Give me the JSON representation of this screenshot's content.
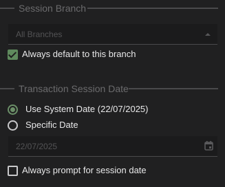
{
  "session_branch": {
    "title": "Session Branch",
    "dropdown_value": "All Branches",
    "default_checkbox_label": "Always default to this branch",
    "default_checked": true
  },
  "transaction_date": {
    "title": "Transaction Session Date",
    "radio_options": [
      {
        "label": "Use System Date (22/07/2025)",
        "selected": true
      },
      {
        "label": "Specific Date",
        "selected": false
      }
    ],
    "date_value": "22/07/2025",
    "prompt_checkbox_label": "Always prompt for session date",
    "prompt_checked": false
  },
  "icons": {
    "dropdown": "chevron-up-icon",
    "calendar": "calendar-icon",
    "checkbox": "check-icon"
  },
  "colors": {
    "background": "#202021",
    "accent_green": "#5f8a5d",
    "text": "#e9e9ea",
    "muted_text": "#6b6b6d"
  }
}
